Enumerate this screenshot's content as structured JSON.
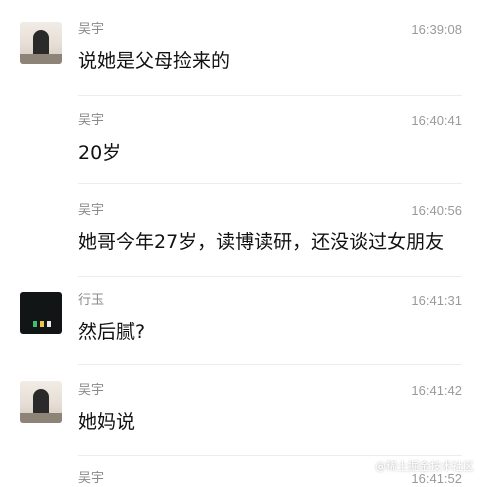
{
  "messages": [
    {
      "sender": "吴宇",
      "time": "16:39:08",
      "text": "说她是父母捡来的",
      "avatar": "wuyu"
    },
    {
      "sender": "吴宇",
      "time": "16:40:41",
      "text": "20岁",
      "avatar": ""
    },
    {
      "sender": "吴宇",
      "time": "16:40:56",
      "text": "她哥今年27岁，读博读研，还没谈过女朋友",
      "avatar": ""
    },
    {
      "sender": "行玉",
      "time": "16:41:31",
      "text": "然后腻?",
      "avatar": "xingyu"
    },
    {
      "sender": "吴宇",
      "time": "16:41:42",
      "text": "她妈说",
      "avatar": "wuyu"
    },
    {
      "sender": "吴宇",
      "time": "16:41:52",
      "text": "",
      "avatar": ""
    }
  ],
  "watermark": "@稀土掘金技术社区",
  "colors": {
    "background": "#ffffff",
    "sender_name": "#8a8a8a",
    "timestamp": "#9a9a9a",
    "message_text": "#111111",
    "divider": "#ededed"
  }
}
